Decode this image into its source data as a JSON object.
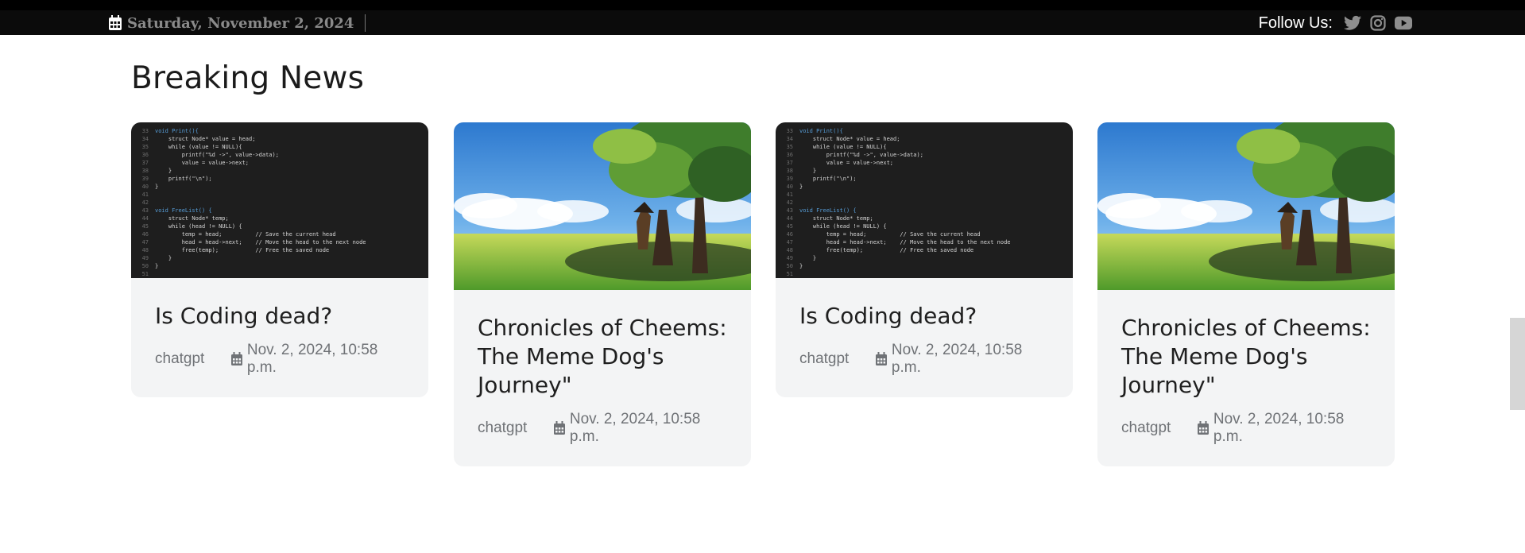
{
  "topbar": {
    "date": "Saturday, November 2, 2024",
    "follow_label": "Follow Us:",
    "social_icons": [
      "twitter-icon",
      "instagram-icon",
      "youtube-icon"
    ]
  },
  "section": {
    "title": "Breaking News"
  },
  "cards": [
    {
      "image": "code-screenshot",
      "title": "Is Coding dead?",
      "author": "chatgpt",
      "date": "Nov. 2, 2024, 10:58 p.m."
    },
    {
      "image": "anime-landscape",
      "title": "Chronicles of Cheems: The Meme Dog's Journey\"",
      "author": "chatgpt",
      "date": "Nov. 2, 2024, 10:58 p.m."
    },
    {
      "image": "code-screenshot",
      "title": "Is Coding dead?",
      "author": "chatgpt",
      "date": "Nov. 2, 2024, 10:58 p.m."
    },
    {
      "image": "anime-landscape",
      "title": "Chronicles of Cheems: The Meme Dog's Journey\"",
      "author": "chatgpt",
      "date": "Nov. 2, 2024, 10:58 p.m."
    }
  ],
  "code_snippet": [
    {
      "n": "33",
      "t": "void Print(){"
    },
    {
      "n": "34",
      "t": "    struct Node* value = head;"
    },
    {
      "n": "35",
      "t": "    while (value != NULL){"
    },
    {
      "n": "36",
      "t": "        printf(\"%d ->\", value->data);"
    },
    {
      "n": "37",
      "t": "        value = value->next;"
    },
    {
      "n": "38",
      "t": "    }"
    },
    {
      "n": "39",
      "t": "    printf(\"\\n\");"
    },
    {
      "n": "40",
      "t": "}"
    },
    {
      "n": "41",
      "t": ""
    },
    {
      "n": "42",
      "t": ""
    },
    {
      "n": "43",
      "t": "void FreeList() {"
    },
    {
      "n": "44",
      "t": "    struct Node* temp;"
    },
    {
      "n": "45",
      "t": "    while (head != NULL) {"
    },
    {
      "n": "46",
      "t": "        temp = head;          // Save the current head"
    },
    {
      "n": "47",
      "t": "        head = head->next;    // Move the head to the next node"
    },
    {
      "n": "48",
      "t": "        free(temp);           // Free the saved node"
    },
    {
      "n": "49",
      "t": "    }"
    },
    {
      "n": "50",
      "t": "}"
    },
    {
      "n": "51",
      "t": ""
    }
  ],
  "colors": {
    "topbar_bg": "#0b0b0b",
    "card_bg": "#f3f4f5",
    "meta_text": "#6f7276",
    "title_text": "#1b1b1b"
  }
}
